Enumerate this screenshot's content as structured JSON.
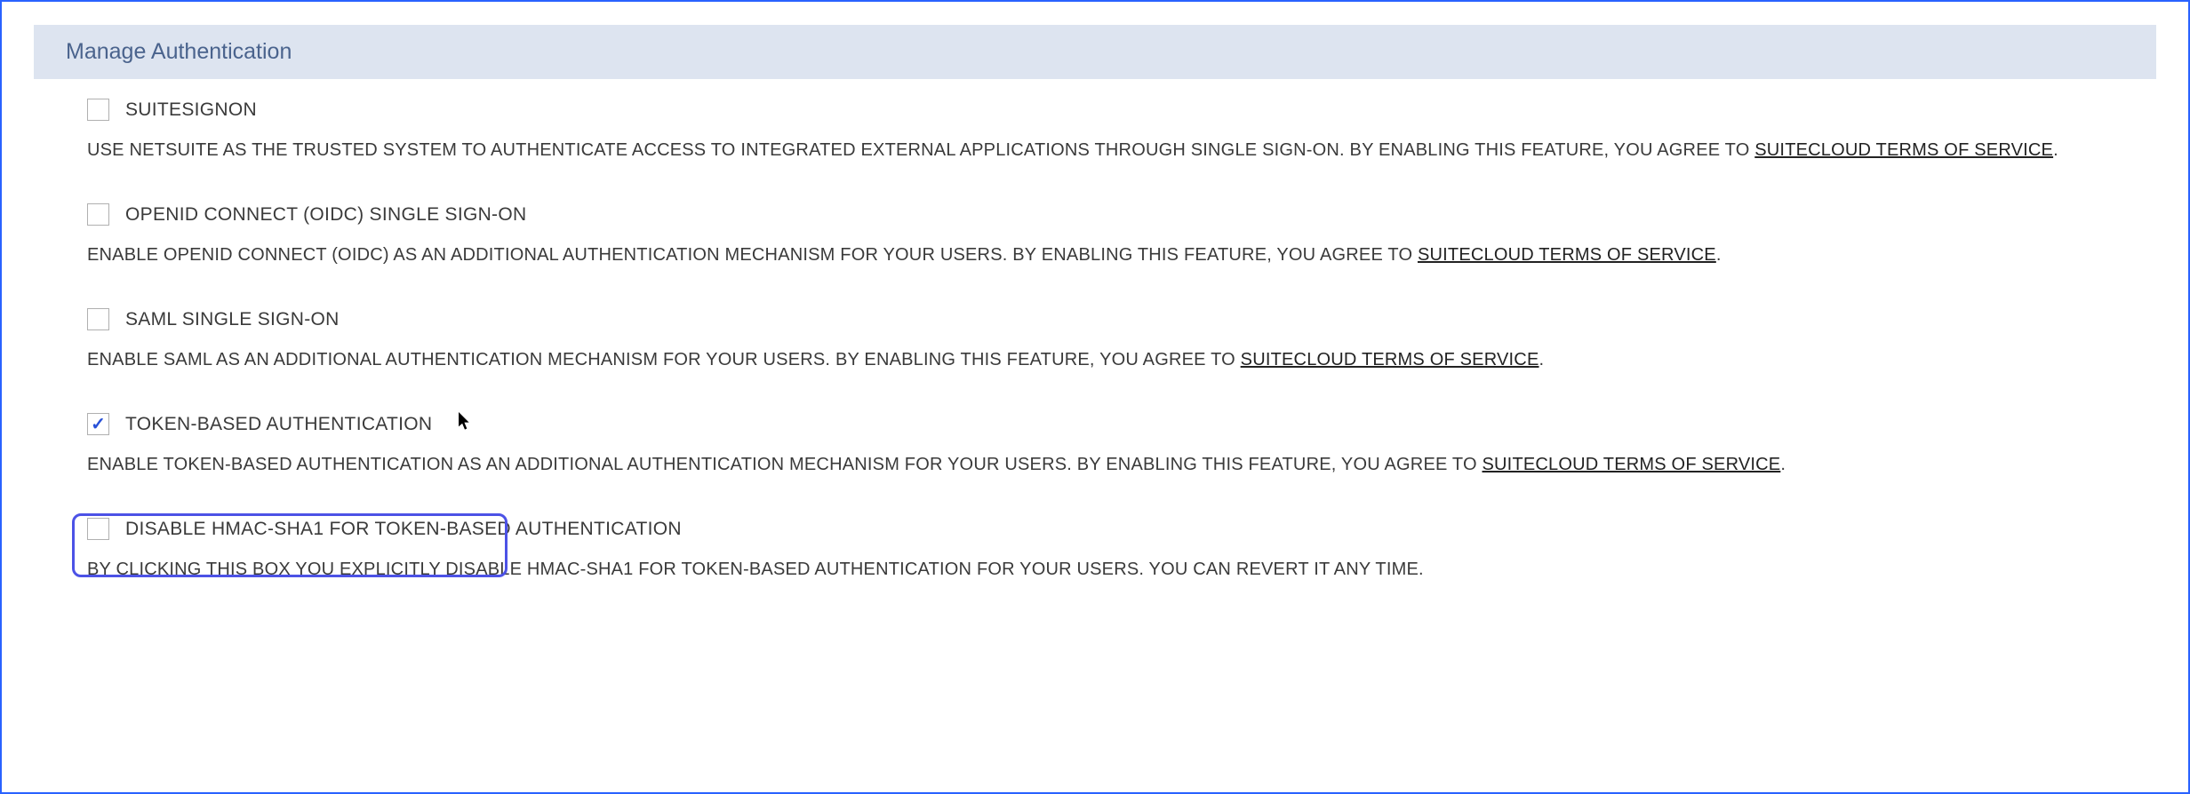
{
  "section": {
    "title": "Manage Authentication"
  },
  "tos_link_text": "SUITECLOUD TERMS OF SERVICE",
  "items": [
    {
      "label": "SUITESIGNON",
      "description_prefix": "USE NETSUITE AS THE TRUSTED SYSTEM TO AUTHENTICATE ACCESS TO INTEGRATED EXTERNAL APPLICATIONS THROUGH SINGLE SIGN-ON. BY ENABLING THIS FEATURE, YOU AGREE TO ",
      "description_suffix": ".",
      "has_tos": true,
      "checked": false
    },
    {
      "label": "OPENID CONNECT (OIDC) SINGLE SIGN-ON",
      "description_prefix": "ENABLE OPENID CONNECT (OIDC) AS AN ADDITIONAL AUTHENTICATION MECHANISM FOR YOUR USERS. BY ENABLING THIS FEATURE, YOU AGREE TO ",
      "description_suffix": ".",
      "has_tos": true,
      "checked": false
    },
    {
      "label": "SAML SINGLE SIGN-ON",
      "description_prefix": "ENABLE SAML AS AN ADDITIONAL AUTHENTICATION MECHANISM FOR YOUR USERS. BY ENABLING THIS FEATURE, YOU AGREE TO ",
      "description_suffix": ".",
      "has_tos": true,
      "checked": false
    },
    {
      "label": "TOKEN-BASED AUTHENTICATION",
      "description_prefix": "ENABLE TOKEN-BASED AUTHENTICATION AS AN ADDITIONAL AUTHENTICATION MECHANISM FOR YOUR USERS. BY ENABLING THIS FEATURE, YOU AGREE TO ",
      "description_suffix": ".",
      "has_tos": true,
      "checked": true
    },
    {
      "label": "DISABLE HMAC-SHA1 FOR TOKEN-BASED AUTHENTICATION",
      "description_prefix": "BY CLICKING THIS BOX YOU EXPLICITLY DISABLE HMAC-SHA1 FOR TOKEN-BASED AUTHENTICATION FOR YOUR USERS. YOU CAN REVERT IT ANY TIME.",
      "description_suffix": "",
      "has_tos": false,
      "checked": false
    }
  ]
}
